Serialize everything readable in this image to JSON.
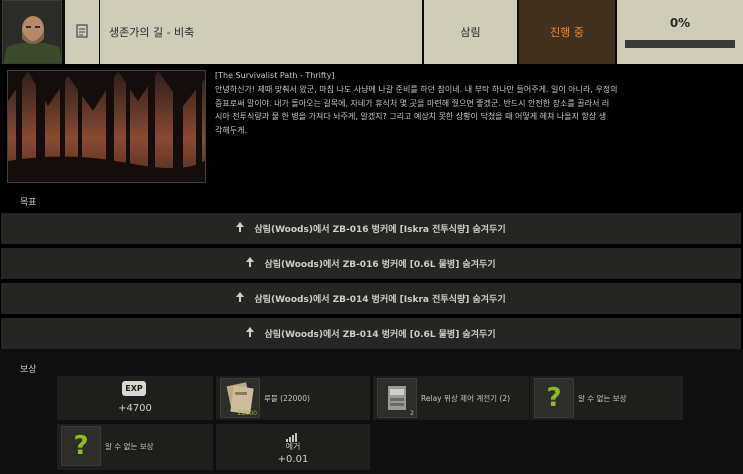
{
  "header": {
    "trader_avatar_icon": "trader-portrait-icon",
    "quest_type_icon": "quest-type-icon",
    "title": "생존가의 길 - 비축",
    "location": "삼림",
    "status": "진행 중",
    "progress_label": "0%",
    "progress_fraction": 0.0,
    "status_color": "#f0872c"
  },
  "description": {
    "image_icon": "forest-image",
    "title": "[The Survivalist Path - Thrifty]",
    "lines": [
      "안녕하신가! 제때 맞춰서 왔군, 마침 나도 사냥에 나갈 준비를 하던 참이네. 내 부탁 하나만 들어주게. 일이 아니라, 우정의",
      "증표로써 말이야. 내가 돌아오는 길목에, 자네가 휴식처 몇 곳을 마련해 줬으면 좋겠군. 반드시 안전한 장소를 골라서 러",
      "시아 전투식량과 물 한 병을 가져다 놔주게, 알겠지? 그리고 예상치 못한 상황이 닥쳤을 때 어떻게 헤쳐 나올지 항상 생",
      "각해두게."
    ]
  },
  "objectives_label": "목표",
  "objectives": [
    "삼림(Woods)에서 ZB-016 벙커에 [Iskra 전투식량] 숨겨두기",
    "삼림(Woods)에서 ZB-016 벙커에 [0.6L 물병] 숨겨두기",
    "삼림(Woods)에서 ZB-014 벙커에 [Iskra 전투식량] 숨겨두기",
    "삼림(Woods)에서 ZB-014 벙커에 [0.6L 물병] 숨겨두기"
  ],
  "rewards_label": "보상",
  "rewards": {
    "exp": {
      "icon": "exp-icon",
      "badge": "EXP",
      "value": "+4700"
    },
    "roubles": {
      "icon": "roubles-icon",
      "label": "루블 (22000)",
      "count": "22000"
    },
    "relay": {
      "icon": "relay-icon",
      "label": "Relay 위상 제어 계전기 (2)",
      "count": "2"
    },
    "unknown1": {
      "icon": "question-mark-icon",
      "glyph": "?",
      "label": "알 수 없는 보상"
    },
    "unknown2": {
      "icon": "question-mark-icon",
      "glyph": "?",
      "label": "알 수 없는 보상"
    },
    "reputation": {
      "icon": "signal-bars-icon",
      "label": "예거",
      "value": "+0.01"
    }
  },
  "colors": {
    "header_bg": "#cfcdb9",
    "status_bg": "#41301d",
    "unknown_green": "#8dbb28"
  }
}
